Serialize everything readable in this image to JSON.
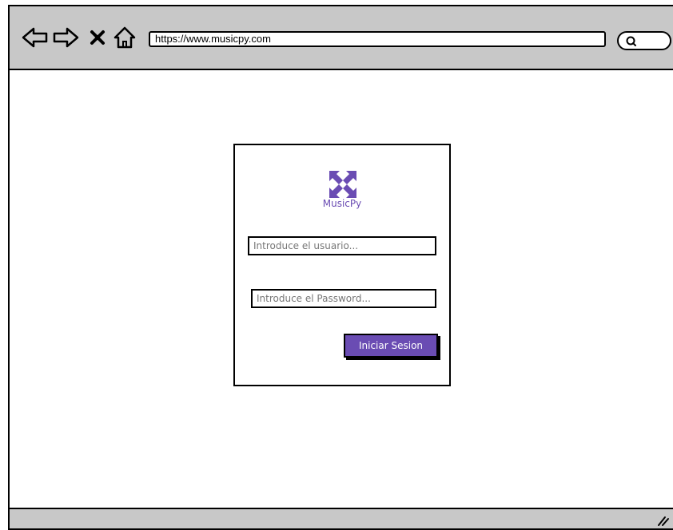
{
  "browser": {
    "url": "https://www.musicpy.com",
    "icons": [
      "back-arrow-icon",
      "forward-arrow-icon",
      "close-icon",
      "home-icon",
      "search-icon"
    ]
  },
  "login": {
    "brand": "MusicPy",
    "username_placeholder": "Introduce el usuario...",
    "password_placeholder": "Introduce el Password...",
    "submit_label": "Iniciar Sesion"
  },
  "colors": {
    "accent": "#6a4cb3",
    "chrome": "#c8c8c8"
  }
}
